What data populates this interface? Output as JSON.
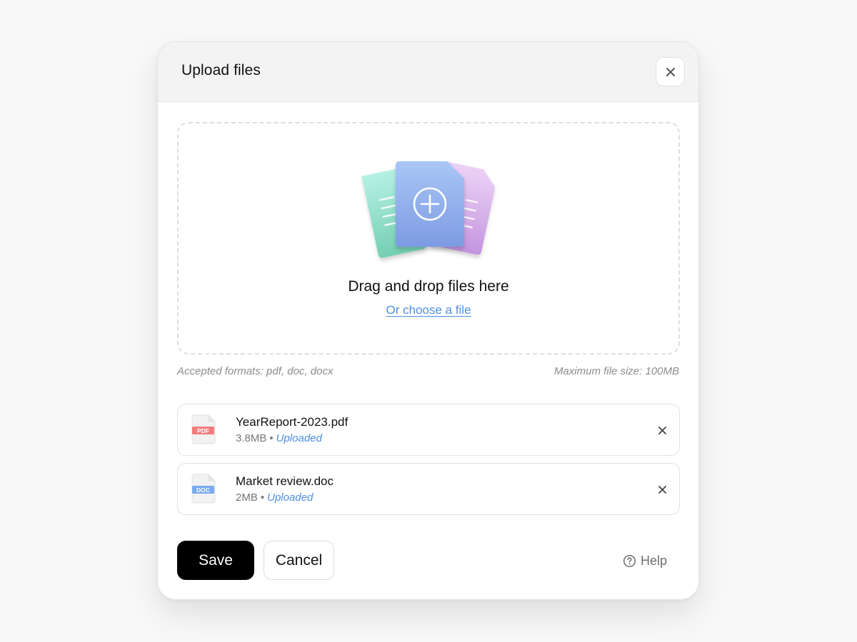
{
  "modal": {
    "title": "Upload files",
    "close_icon": "close-icon"
  },
  "dropzone": {
    "illustration_icon": "files-add-illustration",
    "title": "Drag and drop files here",
    "link_text": "Or choose a file"
  },
  "hints": {
    "formats": "Accepted formats: pdf, doc, docx",
    "max_size": "Maximum file size: 100MB"
  },
  "files": [
    {
      "name": "YearReport-2023.pdf",
      "size": "3.8MB",
      "separator": "•",
      "status": "Uploaded",
      "type_badge": "PDF",
      "badge_color": "#f27b7b",
      "icon": "pdf-file-icon"
    },
    {
      "name": "Market review.doc",
      "size": "2MB",
      "separator": "•",
      "status": "Uploaded",
      "type_badge": "DOC",
      "badge_color": "#7aaaf0",
      "icon": "doc-file-icon"
    }
  ],
  "footer": {
    "save_label": "Save",
    "cancel_label": "Cancel",
    "help_label": "Help",
    "help_icon": "help-circle-icon"
  },
  "colors": {
    "accent": "#4d8fe2",
    "primary_button": "#000000",
    "header_bg": "#f3f3f3"
  }
}
